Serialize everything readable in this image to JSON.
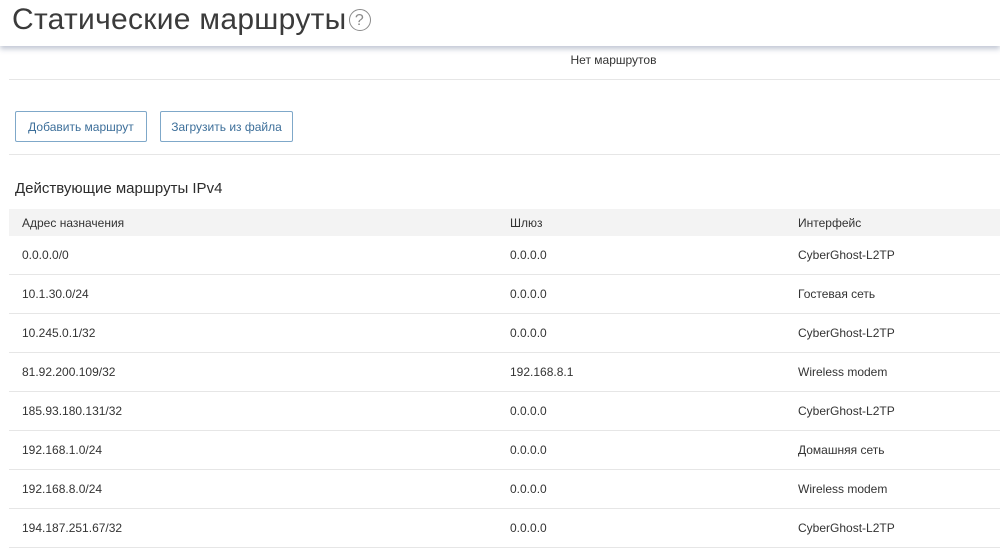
{
  "header": {
    "title": "Статические маршруты",
    "help_symbol": "?"
  },
  "static_routes": {
    "empty_text": "Нет маршрутов"
  },
  "actions": {
    "add_label": "Добавить маршрут",
    "load_label": "Загрузить из файла"
  },
  "active_routes": {
    "title": "Действующие маршруты IPv4",
    "columns": [
      "Адрес назначения",
      "Шлюз",
      "Интерфейс"
    ],
    "rows": [
      [
        "0.0.0.0/0",
        "0.0.0.0",
        "CyberGhost-L2TP"
      ],
      [
        "10.1.30.0/24",
        "0.0.0.0",
        "Гостевая сеть"
      ],
      [
        "10.245.0.1/32",
        "0.0.0.0",
        "CyberGhost-L2TP"
      ],
      [
        "81.92.200.109/32",
        "192.168.8.1",
        "Wireless modem"
      ],
      [
        "185.93.180.131/32",
        "0.0.0.0",
        "CyberGhost-L2TP"
      ],
      [
        "192.168.1.0/24",
        "0.0.0.0",
        "Домашняя сеть"
      ],
      [
        "192.168.8.0/24",
        "0.0.0.0",
        "Wireless modem"
      ],
      [
        "194.187.251.67/32",
        "0.0.0.0",
        "CyberGhost-L2TP"
      ]
    ]
  },
  "icons": {
    "help": "help-circle-icon"
  },
  "colors": {
    "button_border": "#7fa8c9",
    "button_text": "#3d6f9a",
    "header_shadow": "#7882a0",
    "table_header_bg": "#f3f3f3"
  }
}
